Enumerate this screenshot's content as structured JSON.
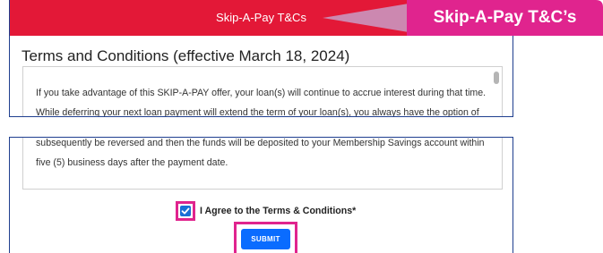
{
  "header": {
    "title": "Skip-A-Pay T&Cs"
  },
  "callout": {
    "label": "Skip-A-Pay T&C’s"
  },
  "terms": {
    "heading": "Terms and Conditions (effective March 18, 2024)",
    "top_text": "If you take advantage of this SKIP-A-PAY offer, your loan(s) will continue to accrue interest during that time. While deferring your next loan payment will extend the term of your loan(s), you always have the option of",
    "bottom_text": "subsequently be reversed and then the funds will be deposited to your Membership Savings account within five (5) business days after the payment date."
  },
  "agreement": {
    "checked": true,
    "label": "I Agree to the Terms & Conditions*"
  },
  "submit": {
    "label": "SUBMIT"
  },
  "colors": {
    "brand_red": "#e31837",
    "callout_pink": "#e0248e",
    "button_blue": "#0a6cff",
    "checkbox_blue": "#1a6fd6",
    "panel_border": "#1f3f8f"
  }
}
